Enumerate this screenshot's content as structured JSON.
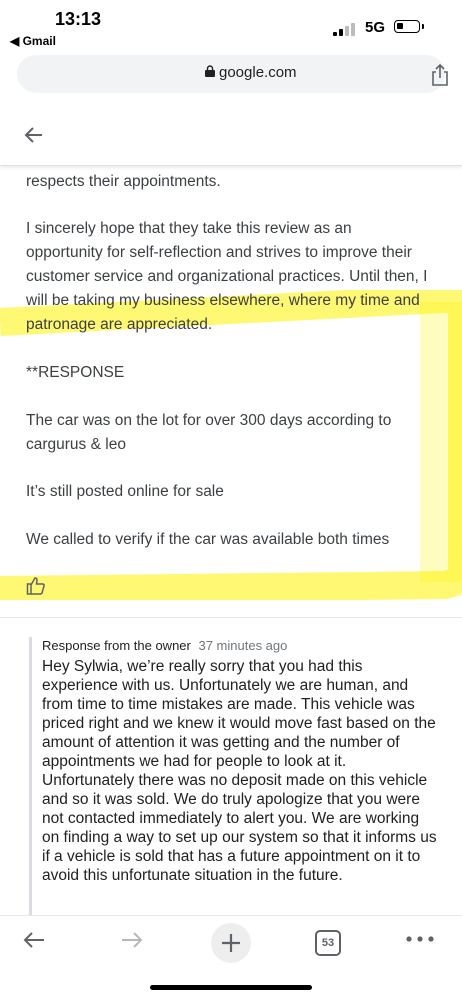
{
  "status_bar": {
    "time": "13:13",
    "back_app": "◀ Gmail",
    "network": "5G"
  },
  "browser": {
    "url": "google.com"
  },
  "review": {
    "paragraphs": [
      "respects their appointments.",
      "I sincerely hope that they take this review as an opportunity for self-reflection and strives to improve their customer service and organizational practices. Until then, I will be taking my business elsewhere, where my time and patronage are appreciated.",
      "**RESPONSE",
      "The car was on the lot for over 300 days according to cargurus & leo",
      "It’s still posted online for sale",
      "We called to verify if the car was available both times"
    ],
    "highlight_color": "#fff200"
  },
  "owner_response": {
    "label": "Response from the owner",
    "time": "37 minutes ago",
    "text": "Hey Sylwia, we’re really sorry that you had this experience with us. Unfortunately we are human, and from time to time mistakes are made. This vehicle was priced right and we knew it would move fast based on the amount of attention it was getting and the number of appointments we had for people to look at it. Unfortunately there was no deposit made on this vehicle and so it was sold. We do truly apologize that you were not contacted immediately to alert you. We are working on finding a way to set up our system so that it informs us if a vehicle is sold that has a future appointment on it to avoid this unfortunate situation in the future."
  },
  "toolbar": {
    "tab_count": "53"
  },
  "icons": [
    "back-arrow-icon",
    "thumbs-up-icon",
    "lock-icon",
    "share-icon",
    "forward-arrow-icon",
    "plus-icon",
    "more-icon"
  ]
}
